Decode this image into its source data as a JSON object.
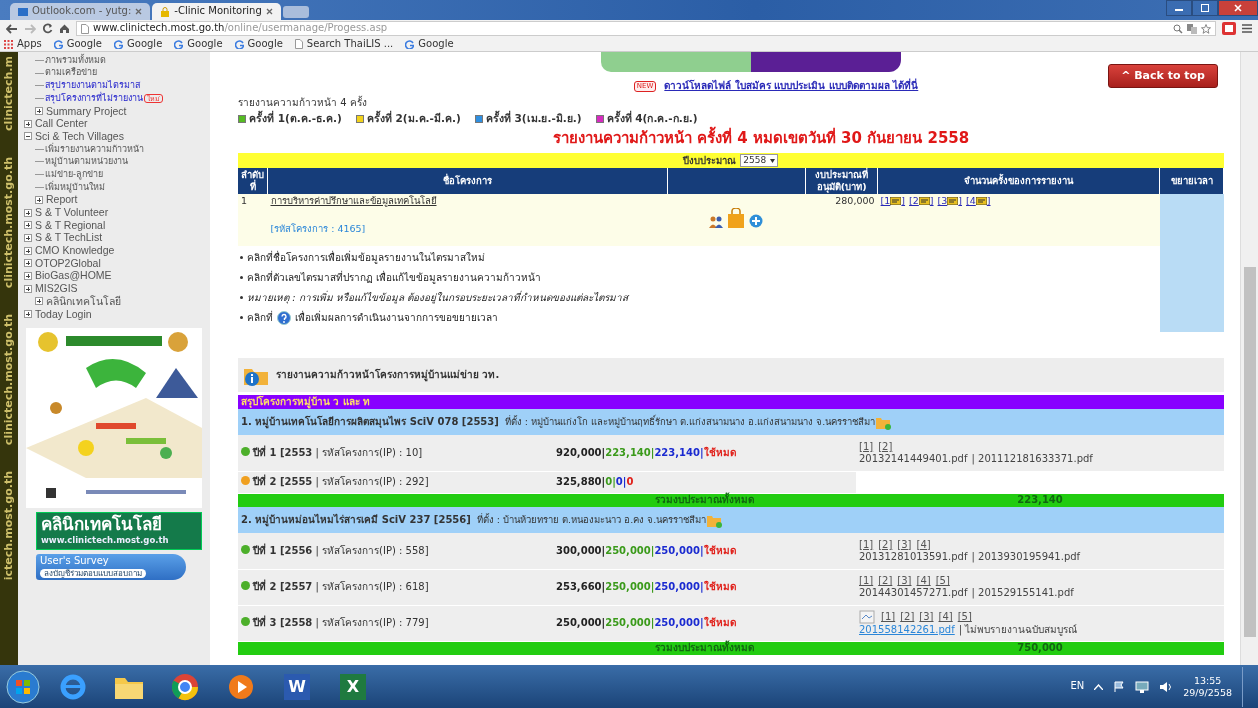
{
  "browser": {
    "tabs": [
      {
        "title": "Outlook.com - yutg:",
        "selected": false
      },
      {
        "title": "-Clinic Monitoring",
        "selected": true
      }
    ],
    "url_host": "www.clinictech.most.go.th",
    "url_path": "/online/usermanage/Progess.asp",
    "bookmarks": [
      {
        "label": "Apps",
        "kind": "apps"
      },
      {
        "label": "Google",
        "kind": "google"
      },
      {
        "label": "Google",
        "kind": "google"
      },
      {
        "label": "Google",
        "kind": "google"
      },
      {
        "label": "Google",
        "kind": "google"
      },
      {
        "label": "Search ThaiLIS ...",
        "kind": "page"
      },
      {
        "label": "Google",
        "kind": "google"
      }
    ]
  },
  "side_strip": [
    "clinictech.m",
    "clinictech.most.go.th",
    "clinictech.most.go.th",
    "ictech.most.go.th"
  ],
  "sidebar": {
    "continued": [
      {
        "label": "ภาพรวมทั้งหมด",
        "highlighted": false
      },
      {
        "label": "ตามเครือข่าย",
        "highlighted": false
      },
      {
        "label": "สรุปรายงานตามไตรมาส",
        "highlighted": true
      },
      {
        "label": "สรุปโครงการที่ไม่รายงาน",
        "highlighted": true,
        "badge": "ใหม่"
      },
      {
        "label": "Summary Project",
        "expanded": false
      }
    ],
    "items": [
      {
        "label": "Call Center",
        "expanded": false
      },
      {
        "label": "Sci & Tech Villages",
        "expanded": true,
        "children": [
          {
            "label": "เพิ่มรายงานความก้าวหน้า",
            "highlighted": false
          },
          {
            "label": "หมู่บ้านตามหน่วยงาน",
            "highlighted": false
          },
          {
            "label": "แม่ข่าย-ลูกข่าย",
            "highlighted": false
          },
          {
            "label": "เพิ่มหมู่บ้านใหม่",
            "highlighted": false
          },
          {
            "label": "Report",
            "expanded": false
          }
        ]
      },
      {
        "label": "S & T Volunteer",
        "expanded": false
      },
      {
        "label": "S & T Regional",
        "expanded": false
      },
      {
        "label": "S & T TechList",
        "expanded": false
      },
      {
        "label": "CMO Knowledge",
        "expanded": false
      },
      {
        "label": "OTOP2Global",
        "expanded": false
      },
      {
        "label": "BioGas@HOME",
        "expanded": false
      },
      {
        "label": "MIS2GIS",
        "expanded": false,
        "children": [
          {
            "label": "คลินิกเทคโนโลยี",
            "expanded": false
          }
        ]
      },
      {
        "label": "Today Login",
        "expanded": false
      }
    ],
    "clinic_banner": {
      "title": "คลินิกเทคโนโลยี",
      "url": "www.clinictech.most.go.th"
    },
    "survey_banner": {
      "title": "User's Survey",
      "subtitle": "ลงบัญชีร่วมตอบแบบสอบถาม"
    }
  },
  "back_to_top": "^ Back to top",
  "download_notice": {
    "badge": "NEW",
    "text": "ดาวน์โหลดไฟล์ ใบสมัคร แบบประเมิน แบบติดตามผล ได้ที่นี่"
  },
  "report_heading": "รายงานความก้าวหน้า 4 ครั้ง",
  "quarters": [
    {
      "label": "ครั้งที่ 1(ต.ค.-ธ.ค.)",
      "color": "#55bb22"
    },
    {
      "label": "ครั้งที่ 2(ม.ค.-มี.ค.)",
      "color": "#f2d21b"
    },
    {
      "label": "ครั้งที่ 3(เม.ย.-มิ.ย.)",
      "color": "#2f8fe0"
    },
    {
      "label": "ครั้งที่ 4(ก.ค.-ก.ย.)",
      "color": "#d62bbf"
    }
  ],
  "deadline": "รายงานความก้าวหน้า ครั้งที่ 4 หมดเขตวันที่ 30  กันยายน 2558",
  "projects_table": {
    "year_label": "ปีงบประมาณ",
    "year_value": "2558",
    "columns": [
      "ลำดับที่",
      "ชื่อโครงการ",
      "งบประมาณที่อนุมัติ(บาท)",
      "จำนวนครั้งของการรายงาน",
      "ขยายเวลา"
    ],
    "rows": [
      {
        "no": "1",
        "name": "การบริหารค่าปรึกษาและข้อมูลเทคโนโลยี",
        "code": "[รหัสโครงการ : 4165]",
        "budget": "280,000",
        "reports": [
          {
            "open": "[1",
            "close": "]"
          },
          {
            "open": "[2",
            "close": "]"
          },
          {
            "open": "[3",
            "close": "]"
          },
          {
            "open": "[4",
            "close": "]"
          }
        ]
      }
    ],
    "notes": [
      {
        "kind": "plain",
        "text": "คลิกที่ชื่อโครงการเพื่อเพิ่มข้อมูลรายงานในไตรมาสใหม่"
      },
      {
        "kind": "plain",
        "text": "คลิกที่ตัวเลขไตรมาสที่ปรากฏ เพื่อแก้ไขข้อมูลรายงานความก้าวหน้า"
      },
      {
        "kind": "italic",
        "text": "หมายเหตุ : การเพิ่ม หรือแก้ไขข้อมูล ต้องอยู่ในกรอบระยะเวลาที่กำหนดของแต่ละไตรมาส"
      },
      {
        "kind": "help",
        "text": "คลิกที่",
        "after": "เพื่อเพิ่มผลการดำเนินงานจากการขอขยายเวลา"
      }
    ]
  },
  "villages_panel": {
    "title": "รายงานความก้าวหน้าโครงการหมู่บ้านแม่ข่าย วท.",
    "summary_bar": "สรุปโครงการหมู่บ้าน ว และ ท",
    "villages": [
      {
        "title": "1. หมู่บ้านเทคโนโลยีการผลิตสมุนไพร  SciV 078 [2553]",
        "location": "ที่ตั้ง : หมู่บ้านแก่งโก และหมู่บ้านฤทธิ์รักษา ต.แก่งสนามนาง อ.แก่งสนามนาง จ.นครราชสีมา",
        "years": [
          {
            "year": "ปีที่ 1 [2553",
            "ip": "| รหัสโครงการ(IP) : 10]",
            "color": "#4caf2a",
            "amounts": [
              "920,000|",
              "223,140|",
              "223,140|",
              "ใช้หมด"
            ],
            "preview": false,
            "reports": [
              "[1]",
              "[2]"
            ],
            "files": [
              {
                "text": "20132141449401.pdf",
                "link": false
              },
              {
                "text": "| 201112181633371.pdf",
                "link": false
              }
            ]
          },
          {
            "year": "ปีที่ 2 [2555",
            "ip": "| รหัสโครงการ(IP) : 292]",
            "color": "#f0a020",
            "amounts": [
              "325,880|",
              "0|",
              "0|",
              "0"
            ],
            "preview": false
          }
        ],
        "total_label": "รวมงบประมาณทั้งหมด",
        "total": "223,140"
      },
      {
        "title": "2. หมู่บ้านหม่อนไหมไร่สารเคมี  SciV 237 [2556]",
        "location": "ที่ตั้ง : บ้านห้วยทราย ต.หนองมะนาว อ.คง จ.นครราชสีมา",
        "years": [
          {
            "year": "ปีที่ 1 [2556",
            "ip": "| รหัสโครงการ(IP) : 558]",
            "color": "#4caf2a",
            "amounts": [
              "300,000|",
              "250,000|",
              "250,000|",
              "ใช้หมด"
            ],
            "preview": false,
            "reports": [
              "[1]",
              "[2]",
              "[3]",
              "[4]"
            ],
            "files": [
              {
                "text": "20131281013591.pdf",
                "link": false
              },
              {
                "text": "| 2013930195941.pdf",
                "link": false
              }
            ]
          },
          {
            "year": "ปีที่ 2 [2557",
            "ip": "| รหัสโครงการ(IP) : 618]",
            "color": "#4caf2a",
            "amounts": [
              "253,660|",
              "250,000|",
              "250,000|",
              "ใช้หมด"
            ],
            "preview": false,
            "reports": [
              "[1]",
              "[2]",
              "[3]",
              "[4]",
              "[5]"
            ],
            "files": [
              {
                "text": "20144301457271.pdf",
                "link": false
              },
              {
                "text": "| 201529155141.pdf",
                "link": false
              }
            ]
          },
          {
            "year": "ปีที่ 3 [2558",
            "ip": "| รหัสโครงการ(IP) : 779]",
            "color": "#4caf2a",
            "amounts": [
              "250,000|",
              "250,000|",
              "250,000|",
              "ใช้หมด"
            ],
            "preview": true,
            "reports": [
              "[1]",
              "[2]",
              "[3]",
              "[4]",
              "[5]"
            ],
            "files": [
              {
                "text": "201558142261.pdf",
                "link": true
              },
              {
                "text": "| ไม่พบรายงานฉบับสมบูรณ์",
                "link": false
              }
            ]
          }
        ],
        "total_label": "รวมงบประมาณทั้งหมด",
        "total": "750,000"
      }
    ]
  },
  "taskbar": {
    "apps": [
      {
        "kind": "ie"
      },
      {
        "kind": "folder"
      },
      {
        "kind": "chrome"
      },
      {
        "kind": "media"
      },
      {
        "kind": "word",
        "glyph": "W"
      },
      {
        "kind": "excel",
        "glyph": "X"
      }
    ],
    "language": "EN",
    "time": "13:55",
    "date": "29/9/2558"
  }
}
